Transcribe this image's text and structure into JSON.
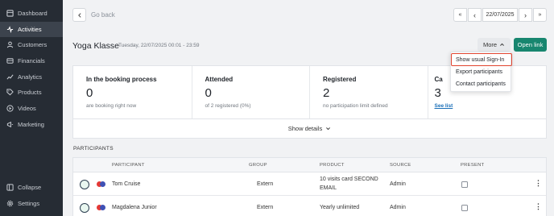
{
  "sidebar": {
    "items": [
      {
        "label": "Dashboard",
        "icon": "dashboard-icon"
      },
      {
        "label": "Activities",
        "icon": "activity-icon"
      },
      {
        "label": "Customers",
        "icon": "user-icon"
      },
      {
        "label": "Financials",
        "icon": "financials-icon"
      },
      {
        "label": "Analytics",
        "icon": "analytics-icon"
      },
      {
        "label": "Products",
        "icon": "tag-icon"
      },
      {
        "label": "Videos",
        "icon": "play-icon"
      },
      {
        "label": "Marketing",
        "icon": "megaphone-icon"
      }
    ],
    "bottom": [
      {
        "label": "Collapse",
        "icon": "collapse-icon"
      },
      {
        "label": "Settings",
        "icon": "gear-icon"
      }
    ]
  },
  "topbar": {
    "back_label": "Go back",
    "first_symbol": "«",
    "prev_symbol": "‹",
    "date": "22/07/2025",
    "next_symbol": "›",
    "last_symbol": "»"
  },
  "header": {
    "title": "Yoga Klasse",
    "subtitle": "Tuesday, 22/07/2025 00:01 - 23:59",
    "more_label": "More",
    "open_link_label": "Open link"
  },
  "dropdown": {
    "items": [
      "Show usual Sign-In",
      "Export participants",
      "Contact participants"
    ]
  },
  "stats": [
    {
      "label": "In the booking process",
      "value": "0",
      "sub": "are booking right now"
    },
    {
      "label": "Attended",
      "value": "0",
      "sub": "of 2 registered (0%)"
    },
    {
      "label": "Registered",
      "value": "2",
      "sub": "no participation limit defined"
    },
    {
      "label": "Ca",
      "value": "3",
      "link": "See list"
    }
  ],
  "details_label": "Show details",
  "participants": {
    "section_title": "PARTICIPANTS",
    "columns": [
      "PARTICIPANT",
      "GROUP",
      "PRODUCT",
      "SOURCE",
      "PRESENT"
    ],
    "rows": [
      {
        "name": "Tom Cruise",
        "group": "Extern",
        "product_line1": "10 visits card SECOND",
        "product_line2": "EMAIL",
        "source": "Admin"
      },
      {
        "name": "Magdalena Junior",
        "group": "Extern",
        "product_line1": "Yearly unlimited",
        "product_line2": "",
        "source": "Admin"
      }
    ]
  },
  "colors": {
    "sidebar_bg": "#262c34",
    "primary": "#18866f",
    "highlight": "#e2442f",
    "link": "#1a6fb8"
  }
}
